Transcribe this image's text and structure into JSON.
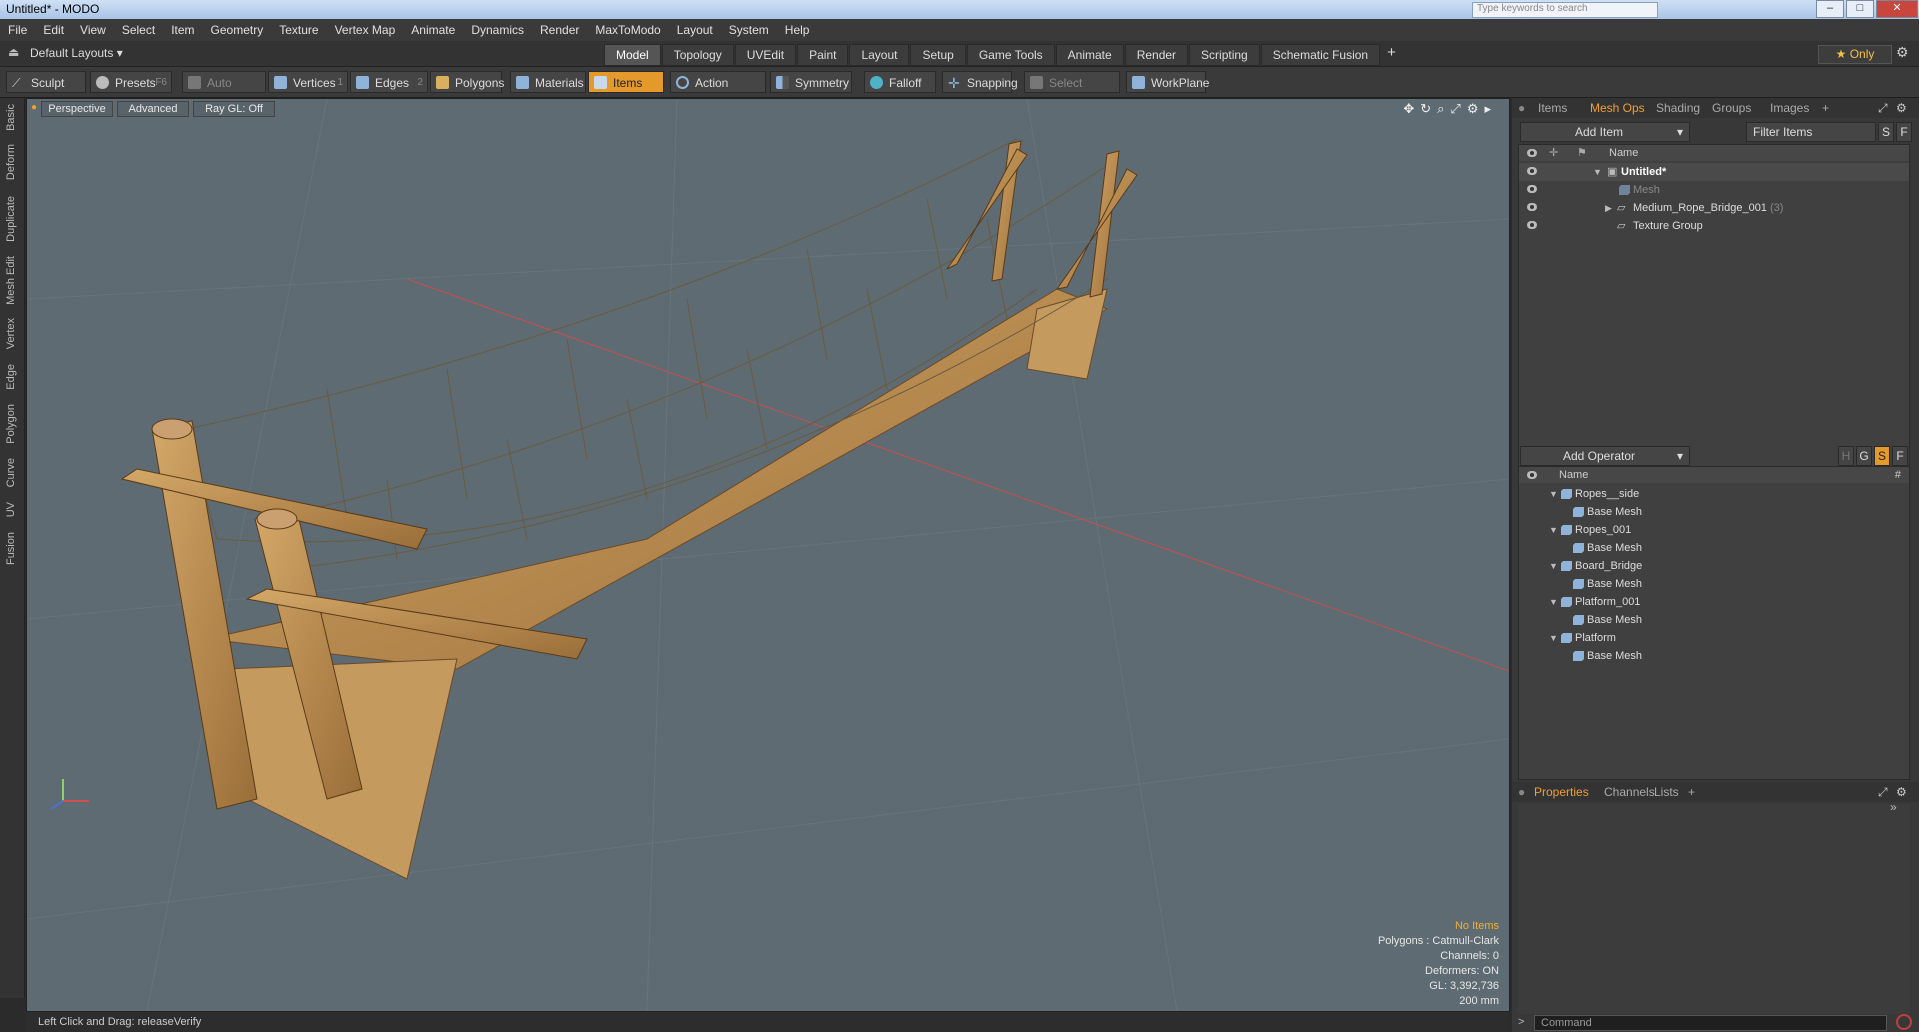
{
  "window": {
    "title": "Untitled* - MODO",
    "search_placeholder": "Type keywords to search"
  },
  "menu": [
    "File",
    "Edit",
    "View",
    "Select",
    "Item",
    "Geometry",
    "Texture",
    "Vertex Map",
    "Animate",
    "Dynamics",
    "Render",
    "MaxToModo",
    "Layout",
    "System",
    "Help"
  ],
  "layouts": {
    "current": "Default Layouts ▾",
    "tabs": [
      "Model",
      "Topology",
      "UVEdit",
      "Paint",
      "Layout",
      "Setup",
      "Game Tools",
      "Animate",
      "Render",
      "Scripting",
      "Schematic Fusion"
    ],
    "add": "+",
    "only": "★ Only"
  },
  "toolbar": {
    "sculpt": "Sculpt",
    "presets": "Presets",
    "presets_key": "F6",
    "auto_select": "Auto Select",
    "vertices": "Vertices",
    "vertices_num": "1",
    "edges": "Edges",
    "edges_num": "2",
    "polygons": "Polygons",
    "materials": "Materials",
    "items": "Items",
    "action_center": "Action Center",
    "symmetry": "Symmetry",
    "falloff": "Falloff",
    "snapping": "Snapping",
    "select_through": "Select Through",
    "workplane": "WorkPlane"
  },
  "left_tabs": [
    "Basic",
    "Deform",
    "Duplicate",
    "Mesh Edit",
    "Vertex",
    "Edge",
    "Polygon",
    "Curve",
    "UV",
    "Fusion"
  ],
  "viewport": {
    "perspective": "Perspective",
    "advanced": "Advanced",
    "raygl": "Ray GL: Off",
    "stats": {
      "no_items": "No Items",
      "polygons": "Polygons : Catmull-Clark",
      "channels": "Channels: 0",
      "deformers": "Deformers: ON",
      "gl": "GL: 3,392,736",
      "scale": "200 mm"
    }
  },
  "status": {
    "text": "Left Click and Drag:  releaseVerify"
  },
  "items_panel": {
    "tabs": [
      "Items",
      "Mesh Ops",
      "Shading",
      "Groups",
      "Images",
      "+"
    ],
    "active_tab": "Mesh Ops",
    "add_item": "Add Item",
    "filter": "Filter Items",
    "sf": [
      "S",
      "F"
    ],
    "header_name": "Name",
    "rows": [
      {
        "label": "Untitled*"
      },
      {
        "label": "Mesh"
      },
      {
        "label": "Medium_Rope_Bridge_001",
        "count": "(3)"
      },
      {
        "label": "Texture Group"
      }
    ]
  },
  "meshops_panel": {
    "add_operator": "Add Operator",
    "flags": [
      "H",
      "G",
      "S",
      "F"
    ],
    "header_name": "Name",
    "header_hash": "#",
    "rows": [
      {
        "label": "Ropes__side"
      },
      {
        "label": "Base Mesh"
      },
      {
        "label": "Ropes_001"
      },
      {
        "label": "Base Mesh"
      },
      {
        "label": "Board_Bridge"
      },
      {
        "label": "Base Mesh"
      },
      {
        "label": "Platform_001"
      },
      {
        "label": "Base Mesh"
      },
      {
        "label": "Platform"
      },
      {
        "label": "Base Mesh"
      }
    ]
  },
  "properties_panel": {
    "tabs": [
      "Properties",
      "Channels",
      "Lists",
      "+"
    ],
    "command_placeholder": "Command"
  },
  "colors": {
    "accent": "#e49a2a",
    "viewport_bg": "#5e6b73",
    "panel_bg": "#383838",
    "wood": "#b8864a",
    "rope": "#6a5a40"
  }
}
